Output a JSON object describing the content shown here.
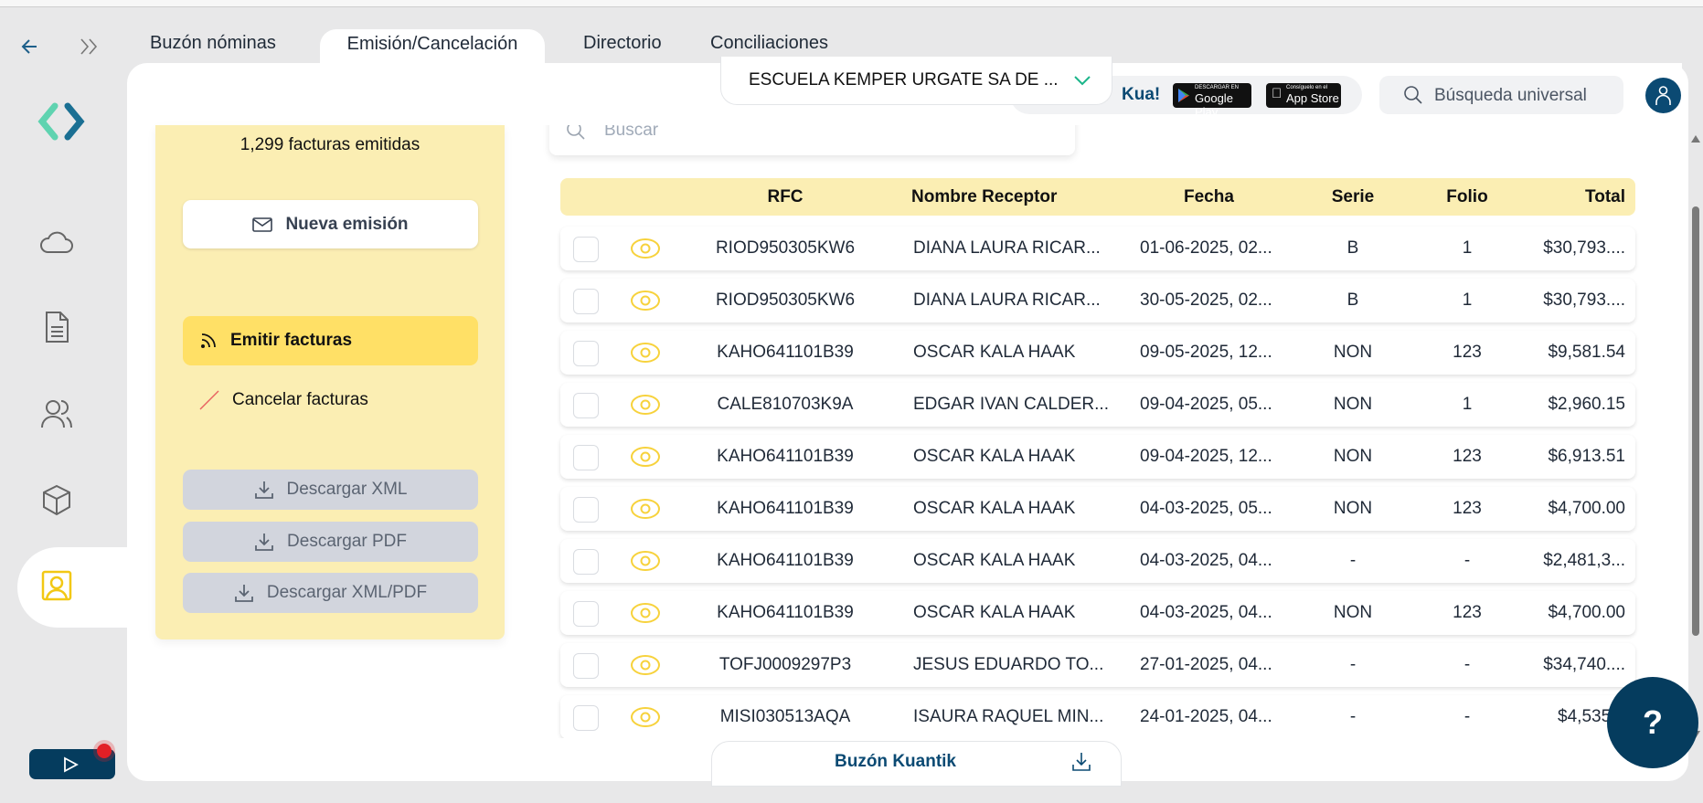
{
  "nav": {
    "back_icon": "arrow-left-icon",
    "expand_icon": "double-chevron-right-icon"
  },
  "tabs": [
    {
      "label": "Buzón nóminas"
    },
    {
      "label": "Emisión/Cancelación",
      "active": true
    },
    {
      "label": "Directorio"
    },
    {
      "label": "Conciliaciones"
    }
  ],
  "header": {
    "company": "ESCUELA KEMPER URGATE SA DE ...",
    "app_promo": "Kua!",
    "google_play_small": "DESCARGAR EN",
    "google_play": "Google Play",
    "app_store_small": "Consíguelo en el",
    "app_store": "App Store",
    "search_placeholder": "Búsqueda universal"
  },
  "sidebar": {
    "icons": [
      "cloud-icon",
      "document-icon",
      "users-icon",
      "box-icon",
      "contact-icon"
    ],
    "active": "contact-icon"
  },
  "panel": {
    "count": "1,299 facturas emitidas",
    "new": "Nueva emisión",
    "emit": "Emitir facturas",
    "cancel": "Cancelar facturas",
    "dl_xml": "Descargar XML",
    "dl_pdf": "Descargar PDF",
    "dl_both": "Descargar XML/PDF"
  },
  "search": {
    "placeholder": "Buscar"
  },
  "table": {
    "headers": {
      "rfc": "RFC",
      "name": "Nombre Receptor",
      "date": "Fecha",
      "serie": "Serie",
      "folio": "Folio",
      "total": "Total"
    },
    "rows": [
      {
        "rfc": "RIOD950305KW6",
        "name": "DIANA LAURA RICAR...",
        "date": "01-06-2025, 02...",
        "serie": "B",
        "folio": "1",
        "total": "$30,793...."
      },
      {
        "rfc": "RIOD950305KW6",
        "name": "DIANA LAURA RICAR...",
        "date": "30-05-2025, 02...",
        "serie": "B",
        "folio": "1",
        "total": "$30,793...."
      },
      {
        "rfc": "KAHO641101B39",
        "name": "OSCAR KALA HAAK",
        "date": "09-05-2025, 12...",
        "serie": "NON",
        "folio": "123",
        "total": "$9,581.54"
      },
      {
        "rfc": "CALE810703K9A",
        "name": "EDGAR IVAN CALDER...",
        "date": "09-04-2025, 05...",
        "serie": "NON",
        "folio": "1",
        "total": "$2,960.15"
      },
      {
        "rfc": "KAHO641101B39",
        "name": "OSCAR KALA HAAK",
        "date": "09-04-2025, 12...",
        "serie": "NON",
        "folio": "123",
        "total": "$6,913.51"
      },
      {
        "rfc": "KAHO641101B39",
        "name": "OSCAR KALA HAAK",
        "date": "04-03-2025, 05...",
        "serie": "NON",
        "folio": "123",
        "total": "$4,700.00"
      },
      {
        "rfc": "KAHO641101B39",
        "name": "OSCAR KALA HAAK",
        "date": "04-03-2025, 04...",
        "serie": "-",
        "folio": "-",
        "total": "$2,481,3..."
      },
      {
        "rfc": "KAHO641101B39",
        "name": "OSCAR KALA HAAK",
        "date": "04-03-2025, 04...",
        "serie": "NON",
        "folio": "123",
        "total": "$4,700.00"
      },
      {
        "rfc": "TOFJ0009297P3",
        "name": "JESUS EDUARDO TO...",
        "date": "27-01-2025, 04...",
        "serie": "-",
        "folio": "-",
        "total": "$34,740...."
      },
      {
        "rfc": "MISI030513AQA",
        "name": "ISAURA RAQUEL MIN...",
        "date": "24-01-2025, 04...",
        "serie": "-",
        "folio": "-",
        "total": "$4,535.0"
      }
    ]
  },
  "footer": {
    "buzon": "Buzón Kuantik",
    "help": "?"
  },
  "colors": {
    "accent_yellow": "#ffe066",
    "panel_yellow": "#fbeeb3",
    "brand_blue": "#0b4a73",
    "brand_teal": "#5fd3b0"
  }
}
